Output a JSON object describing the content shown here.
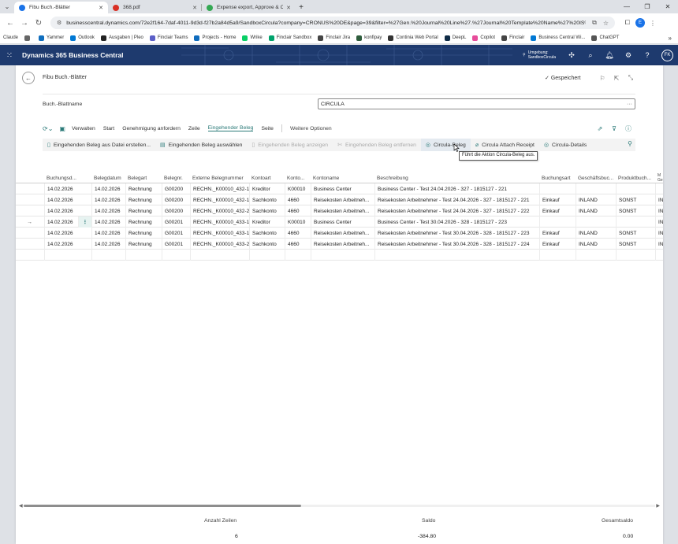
{
  "browser": {
    "tabs": [
      {
        "label": "Fibu Buch.-Blätter",
        "color": "#1a73e8",
        "active": true
      },
      {
        "label": "368.pdf",
        "color": "#d93025",
        "active": false
      },
      {
        "label": "Expense export, Approve & Co",
        "color": "#34a853",
        "active": false
      }
    ],
    "url": "businesscentral.dynamics.com/72e2f164-7daf-4011-9d3d-f27b2a84d5a9/SandboxCircula?company=CRONUS%20DE&page=39&filter=%27Gen.%20Journal%20Line%27.%27Journal%20Template%20Name%27%20IS%...",
    "profile_initial": "E",
    "bookmarks": [
      {
        "label": "Claude",
        "color": "#ffffff"
      },
      {
        "label": "",
        "color": "#666666"
      },
      {
        "label": "Yammer",
        "color": "#106ebe"
      },
      {
        "label": "Outlook",
        "color": "#0078d4"
      },
      {
        "label": "Ausgaben | Pleo",
        "color": "#222222"
      },
      {
        "label": "Finclair Teams",
        "color": "#5b5fc7"
      },
      {
        "label": "Projects - Home",
        "color": "#0f6cbd"
      },
      {
        "label": "Wrike",
        "color": "#08cf65"
      },
      {
        "label": "Finclair Sandbox",
        "color": "#00a36c"
      },
      {
        "label": "Finclair Jira",
        "color": "#444444"
      },
      {
        "label": "konfipay",
        "color": "#2e5c3c"
      },
      {
        "label": "Continia Web Portal",
        "color": "#333333"
      },
      {
        "label": "DeepL",
        "color": "#0f2b46"
      },
      {
        "label": "Copilot",
        "color": "#e74c9a"
      },
      {
        "label": "Finclair",
        "color": "#444444"
      },
      {
        "label": "Business Central Wi...",
        "color": "#0078d4"
      },
      {
        "label": "ChatGPT",
        "color": "#555555"
      }
    ]
  },
  "bc": {
    "app_name": "Dynamics 365 Business Central",
    "env_line1": "Umgebung:",
    "env_line2": "SandboxCircula",
    "user_initials": "FK",
    "header_color": "#1e3a6e"
  },
  "page": {
    "title": "Fibu Buch.-Blätter",
    "saved_label": "Gespeichert",
    "batch_label": "Buch.-Blattname",
    "batch_value": "CIRCULA",
    "actions": [
      "Verwalten",
      "Start",
      "Genehmigung anfordern",
      "Zeile",
      "Eingehender Beleg",
      "Seite"
    ],
    "active_action": "Eingehender Beleg",
    "more_options": "Weitere Optionen",
    "subactions": [
      {
        "label": "Eingehenden Beleg aus Datei erstellen...",
        "icon": "file-icon",
        "disabled": false
      },
      {
        "label": "Eingehenden Beleg auswählen",
        "icon": "select-icon",
        "disabled": false
      },
      {
        "label": "Eingehenden Beleg anzeigen",
        "icon": "doc-icon",
        "disabled": true
      },
      {
        "label": "Eingehenden Beleg entfernen",
        "icon": "remove-icon",
        "disabled": true
      },
      {
        "label": "Circula-Beleg",
        "icon": "globe-icon",
        "disabled": false
      },
      {
        "label": "Circula Attach Receipt",
        "icon": "attach-icon",
        "disabled": false
      },
      {
        "label": "Circula-Details",
        "icon": "globe-icon",
        "disabled": false
      }
    ],
    "tooltip": "Führt die Aktion Circula-Beleg aus."
  },
  "grid": {
    "columns": [
      "Buchungsd...",
      "Belegdatum",
      "Belegart",
      "Belegnr.",
      "Externe Belegnummer",
      "Kontoart",
      "Konto...",
      "Kontoname",
      "Beschreibung",
      "Buchungsart",
      "Geschäftsbuc...",
      "Produktbuch...",
      "M\nGe"
    ],
    "rows": [
      [
        "14.02.2026",
        "14.02.2026",
        "Rechnung",
        "G00200",
        "RECHN._K00010_432-1",
        "Kreditor",
        "K00010",
        "Business Center",
        "Business Center - Test 24.04.2026 - 327 - 1815127 - 221",
        "",
        "",
        "",
        ""
      ],
      [
        "14.02.2026",
        "14.02.2026",
        "Rechnung",
        "G00200",
        "RECHN._K00010_432-1",
        "Sachkonto",
        "4660",
        "Reisekosten Arbeitneh...",
        "Reisekosten Arbeitnehmer - Test 24.04.2026 - 327 - 1815127 - 221",
        "Einkauf",
        "INLAND",
        "SONST",
        "IN"
      ],
      [
        "14.02.2026",
        "14.02.2026",
        "Rechnung",
        "G00200",
        "RECHN._K00010_432-2",
        "Sachkonto",
        "4660",
        "Reisekosten Arbeitneh...",
        "Reisekosten Arbeitnehmer - Test 24.04.2026 - 327 - 1815127 - 222",
        "Einkauf",
        "INLAND",
        "SONST",
        "IN"
      ],
      [
        "14.02.2026",
        "14.02.2026",
        "Rechnung",
        "G00201",
        "RECHN._K00010_433-1",
        "Kreditor",
        "K00010",
        "Business Center",
        "Business Center - Test 30.04.2026 - 328 - 1815127 - 223",
        "",
        "",
        "",
        "IN"
      ],
      [
        "14.02.2026",
        "14.02.2026",
        "Rechnung",
        "G00201",
        "RECHN._K00010_433-1",
        "Sachkonto",
        "4660",
        "Reisekosten Arbeitneh...",
        "Reisekosten Arbeitnehmer - Test 30.04.2026 - 328 - 1815127 - 223",
        "Einkauf",
        "INLAND",
        "SONST",
        "IN"
      ],
      [
        "14.02.2026",
        "14.02.2026",
        "Rechnung",
        "G00201",
        "RECHN._K00010_433-2",
        "Sachkonto",
        "4660",
        "Reisekosten Arbeitneh...",
        "Reisekosten Arbeitnehmer - Test 30.04.2026 - 328 - 1815127 - 224",
        "Einkauf",
        "INLAND",
        "SONST",
        "IN"
      ]
    ],
    "selected_row": 3
  },
  "totals": {
    "count_label": "Anzahl Zeilen",
    "count_value": "6",
    "saldo_label": "Saldo",
    "saldo_value": "-384.80",
    "gesamt_label": "Gesamtsaldo",
    "gesamt_value": "0.00"
  }
}
